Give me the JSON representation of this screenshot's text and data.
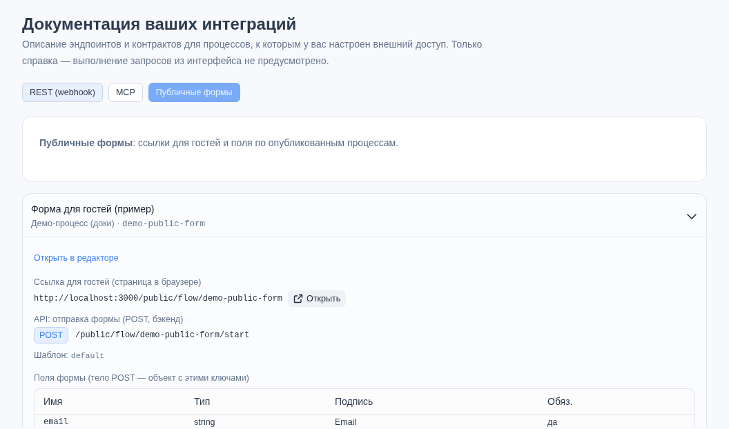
{
  "page": {
    "title": "Документация ваших интеграций",
    "description": "Описание эндпоинтов и контрактов для процессов, к которым у вас настроен внешний доступ. Только справка — выполнение запросов из интерфейса не предусмотрено."
  },
  "tabs": [
    {
      "label": "REST (webhook)",
      "selected": false,
      "hovered": true
    },
    {
      "label": "MCP",
      "selected": false,
      "hovered": false
    },
    {
      "label": "Публичные формы",
      "selected": true,
      "hovered": false
    }
  ],
  "info_card": {
    "text": "**Публичные формы**: ссылки для гостей и поля по опубликованным процессам."
  },
  "forms": [
    {
      "title": "Форма для гостей (пример)",
      "process": "Демо-процесс (доки)",
      "separator": "·",
      "slug": "demo-public-form",
      "expanded": true,
      "editor_link": "Открыть в редакторе",
      "guest_link": {
        "label": "Ссылка для гостей (страница в браузере)",
        "url": "http://localhost:3000/public/flow/demo-public-form",
        "button": "Открыть"
      },
      "api": {
        "label": "API: отправка формы (POST, бэкенд)",
        "method": "POST",
        "path": "/public/flow/demo-public-form/start"
      },
      "template": {
        "label": "Шаблон:",
        "value": "default"
      },
      "fields_table": {
        "caption": "Поля формы (тело POST — объект с этими ключами)",
        "columns": [
          "Имя",
          "Тип",
          "Подпись",
          "Обяз."
        ],
        "rows": [
          [
            "email",
            "string",
            "Email",
            "да"
          ]
        ]
      }
    }
  ]
}
